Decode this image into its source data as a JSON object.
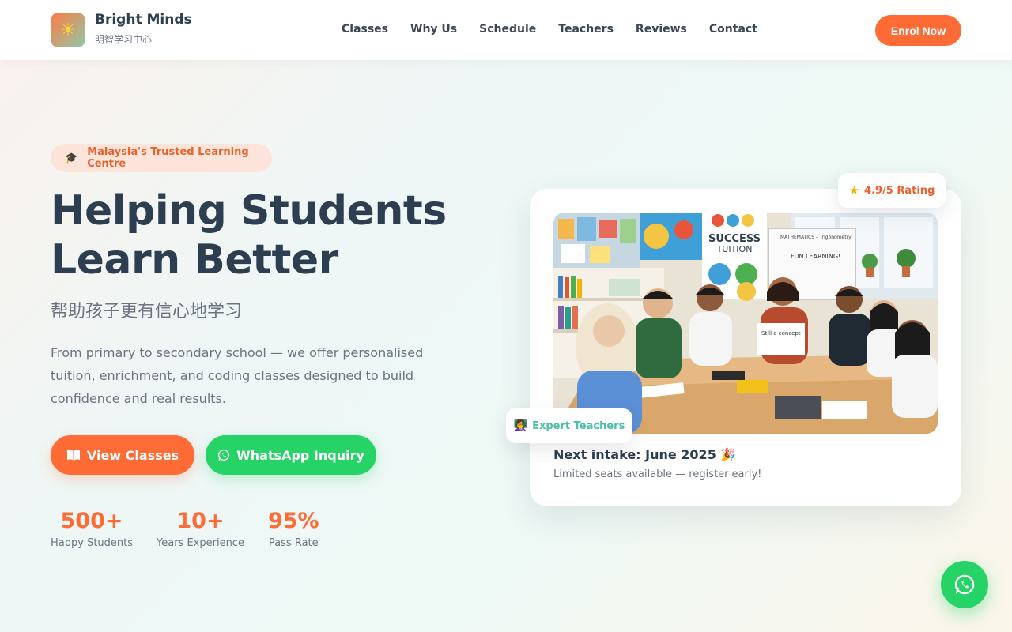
{
  "brand": {
    "name": "Bright Minds",
    "subtitle": "明智学习中心",
    "logo_icon": "sun-icon"
  },
  "nav": {
    "links": [
      "Classes",
      "Why Us",
      "Schedule",
      "Teachers",
      "Reviews",
      "Contact"
    ],
    "cta": "Enrol Now"
  },
  "hero": {
    "badge": "Malaysia's Trusted Learning Centre",
    "badge_icon": "graduation-cap-icon",
    "title_line1": "Helping Students",
    "title_line2": "Learn Better",
    "title_cn": "帮助孩子更有信心地学习",
    "description": "From primary to secondary school — we offer personalised tuition, enrichment, and coding classes designed to build confidence and real results.",
    "primary_button": "View Classes",
    "primary_button_icon": "book-icon",
    "secondary_button": "WhatsApp Inquiry",
    "secondary_button_icon": "whatsapp-icon",
    "stats": [
      {
        "value": "500+",
        "label": "Happy Students"
      },
      {
        "value": "10+",
        "label": "Years Experience"
      },
      {
        "value": "95%",
        "label": "Pass Rate"
      }
    ]
  },
  "card": {
    "rating_badge": "4.9/5 Rating",
    "rating_icon": "star-icon",
    "teachers_badge": "Expert Teachers",
    "teachers_icon": "teacher-icon",
    "intake_title": "Next intake: June 2025 🎉",
    "intake_sub": "Limited seats available — register early!",
    "photo_alt": "Students learning with teacher in classroom",
    "photo_texts": {
      "sign_line1": "SUCCESS",
      "sign_line2": "TUITION",
      "board_title": "MATHEMATICS – Trigonometry",
      "board_text": "FUN LEARNING!",
      "note_text": "Still a concept"
    }
  },
  "colors": {
    "accent": "#ff6b35",
    "whatsapp": "#25d366",
    "dark": "#2c3e50",
    "muted": "#6b7280",
    "teal": "#4dbfa8"
  }
}
